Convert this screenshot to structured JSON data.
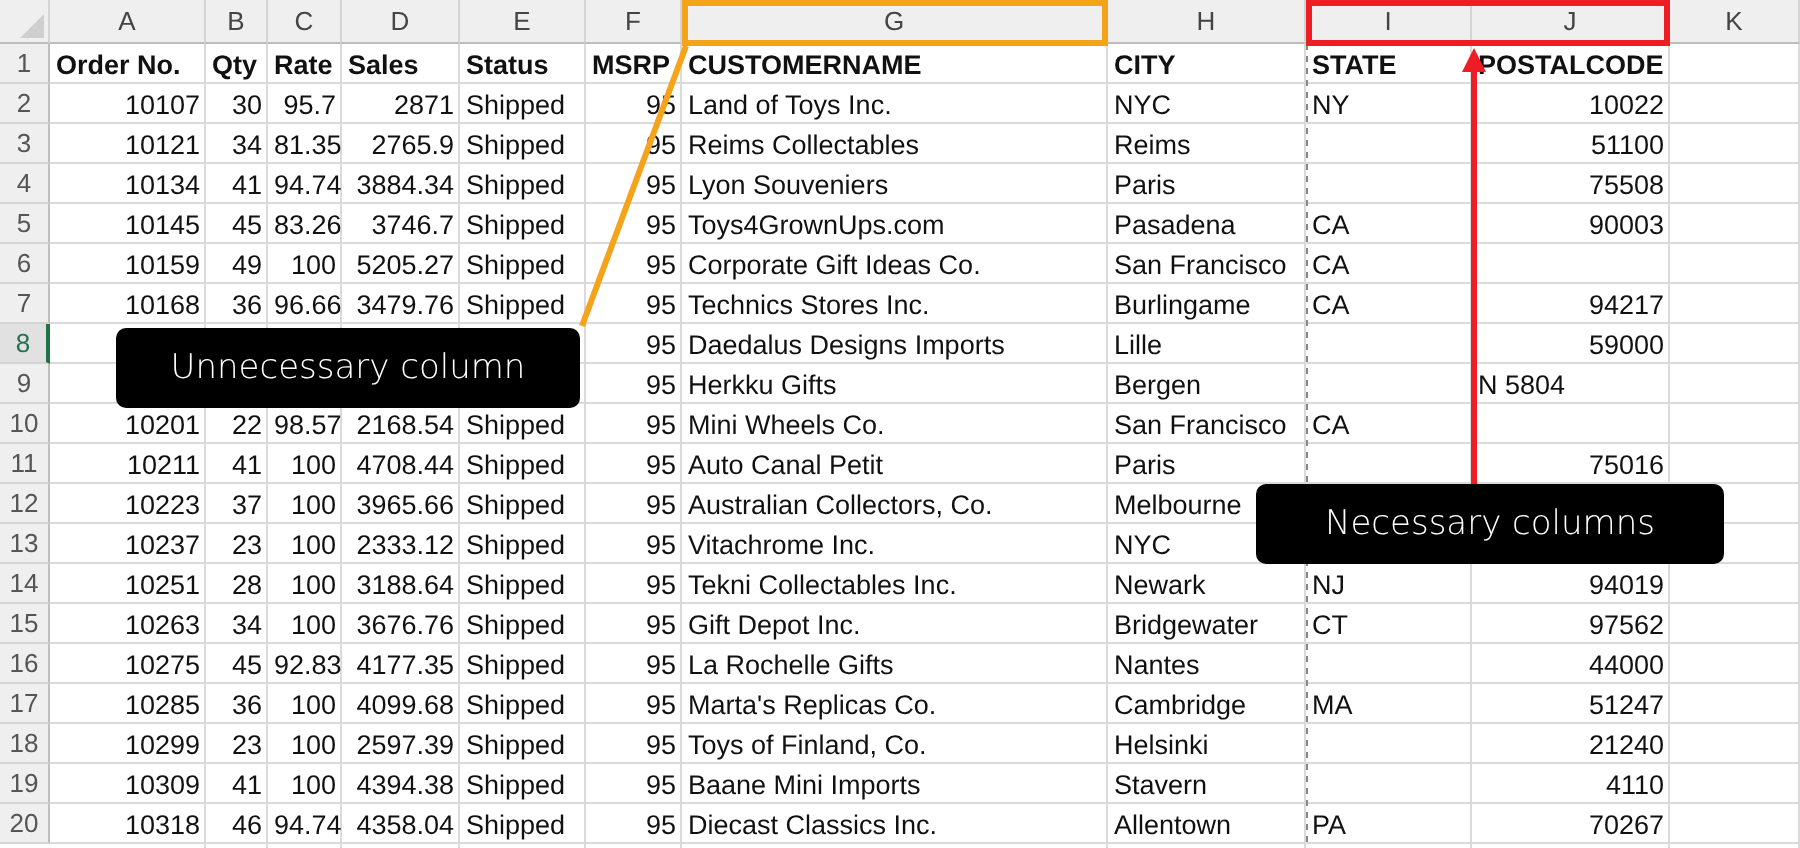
{
  "sheet": {
    "column_headers": [
      "A",
      "B",
      "C",
      "D",
      "E",
      "F",
      "G",
      "H",
      "I",
      "J",
      "K"
    ],
    "rows": [
      {
        "number": "1",
        "selected": false,
        "cells": [
          "Order No.",
          "Qty",
          "Rate",
          "Sales",
          "Status",
          "MSRP",
          "CUSTOMERNAME",
          "CITY",
          "STATE",
          "POSTALCODE",
          null
        ]
      },
      {
        "number": "2",
        "selected": false,
        "cells": [
          "10107",
          "30",
          "95.7",
          "2871",
          "Shipped",
          "95",
          "Land of Toys Inc.",
          "NYC",
          "NY",
          "10022",
          null
        ]
      },
      {
        "number": "3",
        "selected": false,
        "cells": [
          "10121",
          "34",
          "81.35",
          "2765.9",
          "Shipped",
          "95",
          "Reims Collectables",
          "Reims",
          null,
          "51100",
          null
        ]
      },
      {
        "number": "4",
        "selected": false,
        "cells": [
          "10134",
          "41",
          "94.74",
          "3884.34",
          "Shipped",
          "95",
          "Lyon Souveniers",
          "Paris",
          null,
          "75508",
          null
        ]
      },
      {
        "number": "5",
        "selected": false,
        "cells": [
          "10145",
          "45",
          "83.26",
          "3746.7",
          "Shipped",
          "95",
          "Toys4GrownUps.com",
          "Pasadena",
          "CA",
          "90003",
          null
        ]
      },
      {
        "number": "6",
        "selected": false,
        "cells": [
          "10159",
          "49",
          "100",
          "5205.27",
          "Shipped",
          "95",
          "Corporate Gift Ideas Co.",
          "San Francisco",
          "CA",
          null,
          null
        ]
      },
      {
        "number": "7",
        "selected": false,
        "cells": [
          "10168",
          "36",
          "96.66",
          "3479.76",
          "Shipped",
          "95",
          "Technics Stores Inc.",
          "Burlingame",
          "CA",
          "94217",
          null
        ]
      },
      {
        "number": "8",
        "selected": true,
        "cells": [
          null,
          null,
          null,
          null,
          null,
          "95",
          "Daedalus Designs Imports",
          "Lille",
          null,
          "59000",
          null
        ]
      },
      {
        "number": "9",
        "selected": false,
        "cells": [
          null,
          null,
          null,
          null,
          null,
          "95",
          "Herkku Gifts",
          "Bergen",
          null,
          "N 5804",
          null
        ]
      },
      {
        "number": "10",
        "selected": false,
        "cells": [
          "10201",
          "22",
          "98.57",
          "2168.54",
          "Shipped",
          "95",
          "Mini Wheels Co.",
          "San Francisco",
          "CA",
          null,
          null
        ]
      },
      {
        "number": "11",
        "selected": false,
        "cells": [
          "10211",
          "41",
          "100",
          "4708.44",
          "Shipped",
          "95",
          "Auto Canal Petit",
          "Paris",
          null,
          "75016",
          null
        ]
      },
      {
        "number": "12",
        "selected": false,
        "cells": [
          "10223",
          "37",
          "100",
          "3965.66",
          "Shipped",
          "95",
          "Australian Collectors, Co.",
          "Melbourne",
          null,
          null,
          null
        ]
      },
      {
        "number": "13",
        "selected": false,
        "cells": [
          "10237",
          "23",
          "100",
          "2333.12",
          "Shipped",
          "95",
          "Vitachrome Inc.",
          "NYC",
          null,
          null,
          null
        ]
      },
      {
        "number": "14",
        "selected": false,
        "cells": [
          "10251",
          "28",
          "100",
          "3188.64",
          "Shipped",
          "95",
          "Tekni Collectables Inc.",
          "Newark",
          "NJ",
          "94019",
          null
        ]
      },
      {
        "number": "15",
        "selected": false,
        "cells": [
          "10263",
          "34",
          "100",
          "3676.76",
          "Shipped",
          "95",
          "Gift Depot Inc.",
          "Bridgewater",
          "CT",
          "97562",
          null
        ]
      },
      {
        "number": "16",
        "selected": false,
        "cells": [
          "10275",
          "45",
          "92.83",
          "4177.35",
          "Shipped",
          "95",
          "La Rochelle Gifts",
          "Nantes",
          null,
          "44000",
          null
        ]
      },
      {
        "number": "17",
        "selected": false,
        "cells": [
          "10285",
          "36",
          "100",
          "4099.68",
          "Shipped",
          "95",
          "Marta's Replicas Co.",
          "Cambridge",
          "MA",
          "51247",
          null
        ]
      },
      {
        "number": "18",
        "selected": false,
        "cells": [
          "10299",
          "23",
          "100",
          "2597.39",
          "Shipped",
          "95",
          "Toys of Finland, Co.",
          "Helsinki",
          null,
          "21240",
          null
        ]
      },
      {
        "number": "19",
        "selected": false,
        "cells": [
          "10309",
          "41",
          "100",
          "4394.38",
          "Shipped",
          "95",
          "Baane Mini Imports",
          "Stavern",
          null,
          "4110",
          null
        ]
      },
      {
        "number": "20",
        "selected": false,
        "cells": [
          "10318",
          "46",
          "94.74",
          "4358.04",
          "Shipped",
          "95",
          "Diecast Classics Inc.",
          "Allentown",
          "PA",
          "70267",
          null
        ]
      }
    ]
  },
  "annotations": [
    {
      "label": "Unnecessary column",
      "color": "#f5a31a"
    },
    {
      "label": "Necessary columns",
      "color": "#ee1c25"
    }
  ]
}
